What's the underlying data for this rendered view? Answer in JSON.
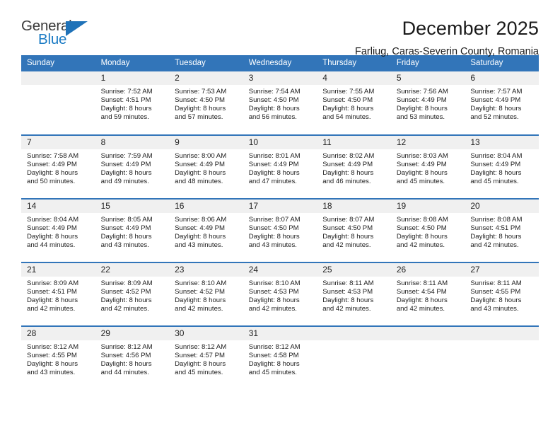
{
  "logo": {
    "word_one": "General",
    "word_two": "Blue",
    "triangle_color": "#1f72b8",
    "text_color": "#3b3b3b",
    "blue_color": "#1b7bc4"
  },
  "header": {
    "title": "December 2025",
    "subtitle": "Farliug, Caras-Severin County, Romania"
  },
  "theme": {
    "header_bg": "#3275b9",
    "daynum_bg": "#f0f0f0",
    "separator": "#3275b9"
  },
  "weekdays": [
    "Sunday",
    "Monday",
    "Tuesday",
    "Wednesday",
    "Thursday",
    "Friday",
    "Saturday"
  ],
  "weeks": [
    [
      {
        "day": "",
        "sunrise": "",
        "sunset": "",
        "daylight1": "",
        "daylight2": ""
      },
      {
        "day": "1",
        "sunrise": "Sunrise: 7:52 AM",
        "sunset": "Sunset: 4:51 PM",
        "daylight1": "Daylight: 8 hours",
        "daylight2": "and 59 minutes."
      },
      {
        "day": "2",
        "sunrise": "Sunrise: 7:53 AM",
        "sunset": "Sunset: 4:50 PM",
        "daylight1": "Daylight: 8 hours",
        "daylight2": "and 57 minutes."
      },
      {
        "day": "3",
        "sunrise": "Sunrise: 7:54 AM",
        "sunset": "Sunset: 4:50 PM",
        "daylight1": "Daylight: 8 hours",
        "daylight2": "and 56 minutes."
      },
      {
        "day": "4",
        "sunrise": "Sunrise: 7:55 AM",
        "sunset": "Sunset: 4:50 PM",
        "daylight1": "Daylight: 8 hours",
        "daylight2": "and 54 minutes."
      },
      {
        "day": "5",
        "sunrise": "Sunrise: 7:56 AM",
        "sunset": "Sunset: 4:49 PM",
        "daylight1": "Daylight: 8 hours",
        "daylight2": "and 53 minutes."
      },
      {
        "day": "6",
        "sunrise": "Sunrise: 7:57 AM",
        "sunset": "Sunset: 4:49 PM",
        "daylight1": "Daylight: 8 hours",
        "daylight2": "and 52 minutes."
      }
    ],
    [
      {
        "day": "7",
        "sunrise": "Sunrise: 7:58 AM",
        "sunset": "Sunset: 4:49 PM",
        "daylight1": "Daylight: 8 hours",
        "daylight2": "and 50 minutes."
      },
      {
        "day": "8",
        "sunrise": "Sunrise: 7:59 AM",
        "sunset": "Sunset: 4:49 PM",
        "daylight1": "Daylight: 8 hours",
        "daylight2": "and 49 minutes."
      },
      {
        "day": "9",
        "sunrise": "Sunrise: 8:00 AM",
        "sunset": "Sunset: 4:49 PM",
        "daylight1": "Daylight: 8 hours",
        "daylight2": "and 48 minutes."
      },
      {
        "day": "10",
        "sunrise": "Sunrise: 8:01 AM",
        "sunset": "Sunset: 4:49 PM",
        "daylight1": "Daylight: 8 hours",
        "daylight2": "and 47 minutes."
      },
      {
        "day": "11",
        "sunrise": "Sunrise: 8:02 AM",
        "sunset": "Sunset: 4:49 PM",
        "daylight1": "Daylight: 8 hours",
        "daylight2": "and 46 minutes."
      },
      {
        "day": "12",
        "sunrise": "Sunrise: 8:03 AM",
        "sunset": "Sunset: 4:49 PM",
        "daylight1": "Daylight: 8 hours",
        "daylight2": "and 45 minutes."
      },
      {
        "day": "13",
        "sunrise": "Sunrise: 8:04 AM",
        "sunset": "Sunset: 4:49 PM",
        "daylight1": "Daylight: 8 hours",
        "daylight2": "and 45 minutes."
      }
    ],
    [
      {
        "day": "14",
        "sunrise": "Sunrise: 8:04 AM",
        "sunset": "Sunset: 4:49 PM",
        "daylight1": "Daylight: 8 hours",
        "daylight2": "and 44 minutes."
      },
      {
        "day": "15",
        "sunrise": "Sunrise: 8:05 AM",
        "sunset": "Sunset: 4:49 PM",
        "daylight1": "Daylight: 8 hours",
        "daylight2": "and 43 minutes."
      },
      {
        "day": "16",
        "sunrise": "Sunrise: 8:06 AM",
        "sunset": "Sunset: 4:49 PM",
        "daylight1": "Daylight: 8 hours",
        "daylight2": "and 43 minutes."
      },
      {
        "day": "17",
        "sunrise": "Sunrise: 8:07 AM",
        "sunset": "Sunset: 4:50 PM",
        "daylight1": "Daylight: 8 hours",
        "daylight2": "and 43 minutes."
      },
      {
        "day": "18",
        "sunrise": "Sunrise: 8:07 AM",
        "sunset": "Sunset: 4:50 PM",
        "daylight1": "Daylight: 8 hours",
        "daylight2": "and 42 minutes."
      },
      {
        "day": "19",
        "sunrise": "Sunrise: 8:08 AM",
        "sunset": "Sunset: 4:50 PM",
        "daylight1": "Daylight: 8 hours",
        "daylight2": "and 42 minutes."
      },
      {
        "day": "20",
        "sunrise": "Sunrise: 8:08 AM",
        "sunset": "Sunset: 4:51 PM",
        "daylight1": "Daylight: 8 hours",
        "daylight2": "and 42 minutes."
      }
    ],
    [
      {
        "day": "21",
        "sunrise": "Sunrise: 8:09 AM",
        "sunset": "Sunset: 4:51 PM",
        "daylight1": "Daylight: 8 hours",
        "daylight2": "and 42 minutes."
      },
      {
        "day": "22",
        "sunrise": "Sunrise: 8:09 AM",
        "sunset": "Sunset: 4:52 PM",
        "daylight1": "Daylight: 8 hours",
        "daylight2": "and 42 minutes."
      },
      {
        "day": "23",
        "sunrise": "Sunrise: 8:10 AM",
        "sunset": "Sunset: 4:52 PM",
        "daylight1": "Daylight: 8 hours",
        "daylight2": "and 42 minutes."
      },
      {
        "day": "24",
        "sunrise": "Sunrise: 8:10 AM",
        "sunset": "Sunset: 4:53 PM",
        "daylight1": "Daylight: 8 hours",
        "daylight2": "and 42 minutes."
      },
      {
        "day": "25",
        "sunrise": "Sunrise: 8:11 AM",
        "sunset": "Sunset: 4:53 PM",
        "daylight1": "Daylight: 8 hours",
        "daylight2": "and 42 minutes."
      },
      {
        "day": "26",
        "sunrise": "Sunrise: 8:11 AM",
        "sunset": "Sunset: 4:54 PM",
        "daylight1": "Daylight: 8 hours",
        "daylight2": "and 42 minutes."
      },
      {
        "day": "27",
        "sunrise": "Sunrise: 8:11 AM",
        "sunset": "Sunset: 4:55 PM",
        "daylight1": "Daylight: 8 hours",
        "daylight2": "and 43 minutes."
      }
    ],
    [
      {
        "day": "28",
        "sunrise": "Sunrise: 8:12 AM",
        "sunset": "Sunset: 4:55 PM",
        "daylight1": "Daylight: 8 hours",
        "daylight2": "and 43 minutes."
      },
      {
        "day": "29",
        "sunrise": "Sunrise: 8:12 AM",
        "sunset": "Sunset: 4:56 PM",
        "daylight1": "Daylight: 8 hours",
        "daylight2": "and 44 minutes."
      },
      {
        "day": "30",
        "sunrise": "Sunrise: 8:12 AM",
        "sunset": "Sunset: 4:57 PM",
        "daylight1": "Daylight: 8 hours",
        "daylight2": "and 45 minutes."
      },
      {
        "day": "31",
        "sunrise": "Sunrise: 8:12 AM",
        "sunset": "Sunset: 4:58 PM",
        "daylight1": "Daylight: 8 hours",
        "daylight2": "and 45 minutes."
      },
      {
        "day": "",
        "sunrise": "",
        "sunset": "",
        "daylight1": "",
        "daylight2": ""
      },
      {
        "day": "",
        "sunrise": "",
        "sunset": "",
        "daylight1": "",
        "daylight2": ""
      },
      {
        "day": "",
        "sunrise": "",
        "sunset": "",
        "daylight1": "",
        "daylight2": ""
      }
    ]
  ]
}
